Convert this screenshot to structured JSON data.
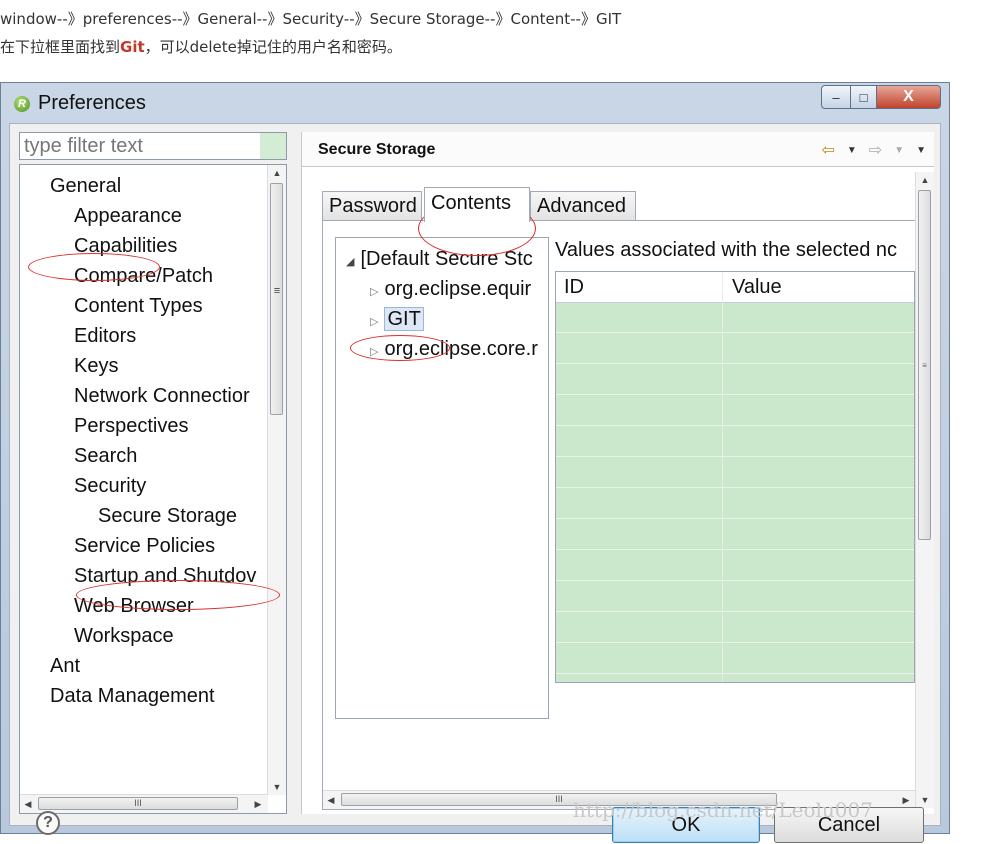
{
  "article": {
    "path_line": "window--》preferences--》General--》Security--》Secure Storage--》Content--》GIT",
    "note_prefix": "在下拉框里面找到",
    "note_highlight": "Git",
    "note_suffix": "，可以delete掉记住的用户名和密码。"
  },
  "window": {
    "title": "Preferences",
    "controls": {
      "minimize": "–",
      "maximize": "□",
      "close": "X"
    }
  },
  "sidebar": {
    "filter_placeholder": "type filter text",
    "items": [
      {
        "label": "General"
      },
      {
        "label": "Appearance"
      },
      {
        "label": "Capabilities"
      },
      {
        "label": "Compare/Patch"
      },
      {
        "label": "Content Types"
      },
      {
        "label": "Editors"
      },
      {
        "label": "Keys"
      },
      {
        "label": "Network Connectior"
      },
      {
        "label": "Perspectives"
      },
      {
        "label": "Search"
      },
      {
        "label": "Security"
      },
      {
        "label": "Secure Storage"
      },
      {
        "label": "Service Policies"
      },
      {
        "label": "Startup and Shutdov"
      },
      {
        "label": "Web Browser"
      },
      {
        "label": "Workspace"
      },
      {
        "label": "Ant"
      },
      {
        "label": "Data Management"
      }
    ],
    "scrollbar_grip": "≡",
    "hscroll_grip": "III"
  },
  "page": {
    "title": "Secure Storage",
    "nav": {
      "back": "⇦",
      "dropdown": "▼",
      "forward": "⇨",
      "menu": "▼"
    },
    "tabs": [
      {
        "label": "Password"
      },
      {
        "label": "Contents"
      },
      {
        "label": "Advanced"
      }
    ],
    "storage_tree": [
      {
        "label": "[Default Secure Stc"
      },
      {
        "label": "org.eclipse.equir"
      },
      {
        "label": "GIT"
      },
      {
        "label": "org.eclipse.core.r"
      }
    ],
    "values_label": "Values associated with the selected nc",
    "table_headers": {
      "id": "ID",
      "value": "Value"
    },
    "outer_scroll_grip": "≡",
    "inner_hscroll_grip": "III"
  },
  "footer": {
    "help": "?",
    "ok_label": "OK",
    "cancel_label": "Cancel",
    "watermark": "http://blog.csdn.net/Leolu007"
  },
  "colors": {
    "highlight_red": "#c0392b",
    "annotation_circle": "#d9302c",
    "table_fill": "#cce8cc"
  }
}
